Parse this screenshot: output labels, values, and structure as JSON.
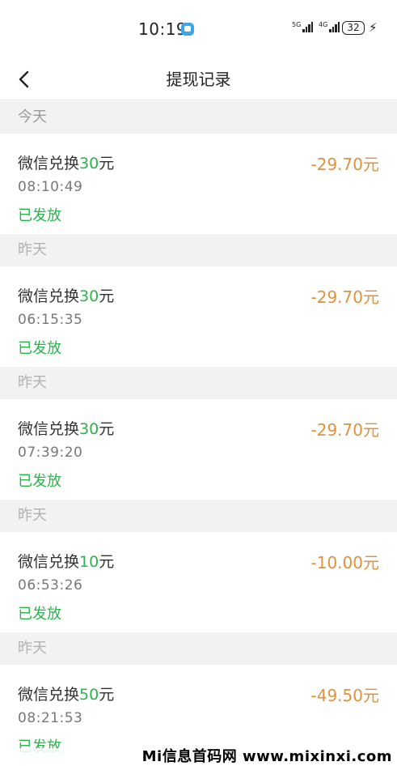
{
  "status_bar": {
    "time": "10:19",
    "network1": "5G",
    "network2": "4G",
    "battery": "32"
  },
  "nav": {
    "title": "提现记录"
  },
  "sections": [
    {
      "header": "今天",
      "title_prefix": "微信兑换",
      "title_amount": "30",
      "title_suffix": "元",
      "time": "08:10:49",
      "status": "已发放",
      "amount": "-29.70元"
    },
    {
      "header": "昨天",
      "title_prefix": "微信兑换",
      "title_amount": "30",
      "title_suffix": "元",
      "time": "06:15:35",
      "status": "已发放",
      "amount": "-29.70元"
    },
    {
      "header": "昨天",
      "title_prefix": "微信兑换",
      "title_amount": "30",
      "title_suffix": "元",
      "time": "07:39:20",
      "status": "已发放",
      "amount": "-29.70元"
    },
    {
      "header": "昨天",
      "title_prefix": "微信兑换",
      "title_amount": "10",
      "title_suffix": "元",
      "time": "06:53:26",
      "status": "已发放",
      "amount": "-10.00元"
    },
    {
      "header": "昨天",
      "title_prefix": "微信兑换",
      "title_amount": "50",
      "title_suffix": "元",
      "time": "08:21:53",
      "status": "已发放",
      "amount": "-49.50元"
    }
  ],
  "watermark": "Mi信息首码网 www.mixinxi.com",
  "colors": {
    "status_green": "#29b34a",
    "amount_orange": "#e0913a",
    "section_bg": "#f2f2f2"
  }
}
